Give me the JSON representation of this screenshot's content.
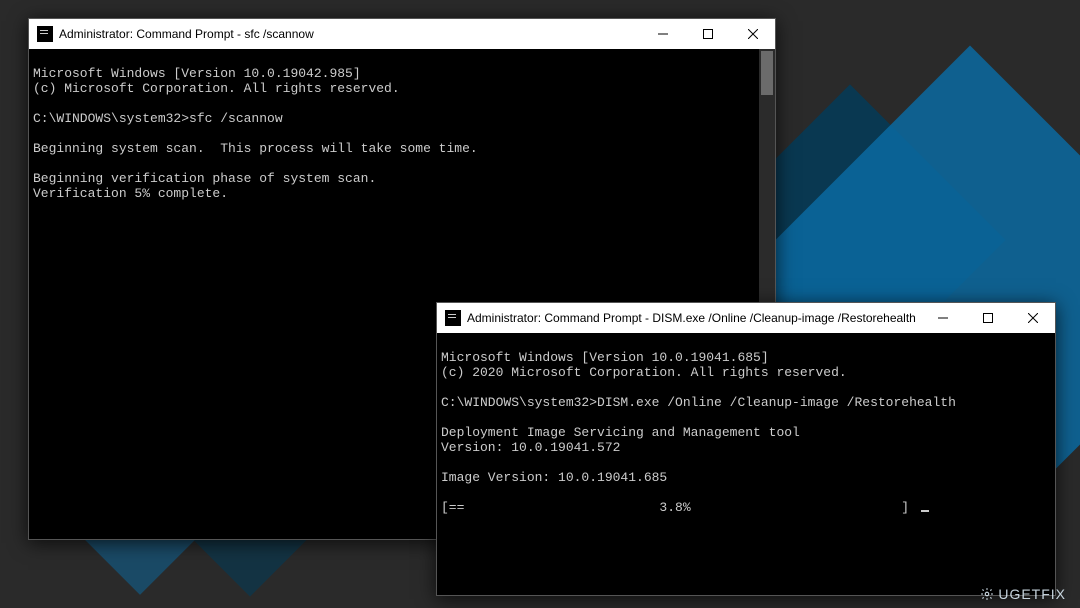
{
  "watermark": "UGETFIX",
  "window1": {
    "title": "Administrator: Command Prompt - sfc /scannow",
    "lines": {
      "l0": "Microsoft Windows [Version 10.0.19042.985]",
      "l1": "(c) Microsoft Corporation. All rights reserved.",
      "l2": "",
      "l3": "C:\\WINDOWS\\system32>sfc /scannow",
      "l4": "",
      "l5": "Beginning system scan.  This process will take some time.",
      "l6": "",
      "l7": "Beginning verification phase of system scan.",
      "l8": "Verification 5% complete."
    }
  },
  "window2": {
    "title": "Administrator: Command Prompt - DISM.exe /Online /Cleanup-image /Restorehealth",
    "lines": {
      "l0": "Microsoft Windows [Version 10.0.19041.685]",
      "l1": "(c) 2020 Microsoft Corporation. All rights reserved.",
      "l2": "",
      "l3": "C:\\WINDOWS\\system32>DISM.exe /Online /Cleanup-image /Restorehealth",
      "l4": "",
      "l5": "Deployment Image Servicing and Management tool",
      "l6": "Version: 10.0.19041.572",
      "l7": "",
      "l8": "Image Version: 10.0.19041.685",
      "l9": "",
      "l10": "[==                         3.8%                           ] "
    }
  }
}
